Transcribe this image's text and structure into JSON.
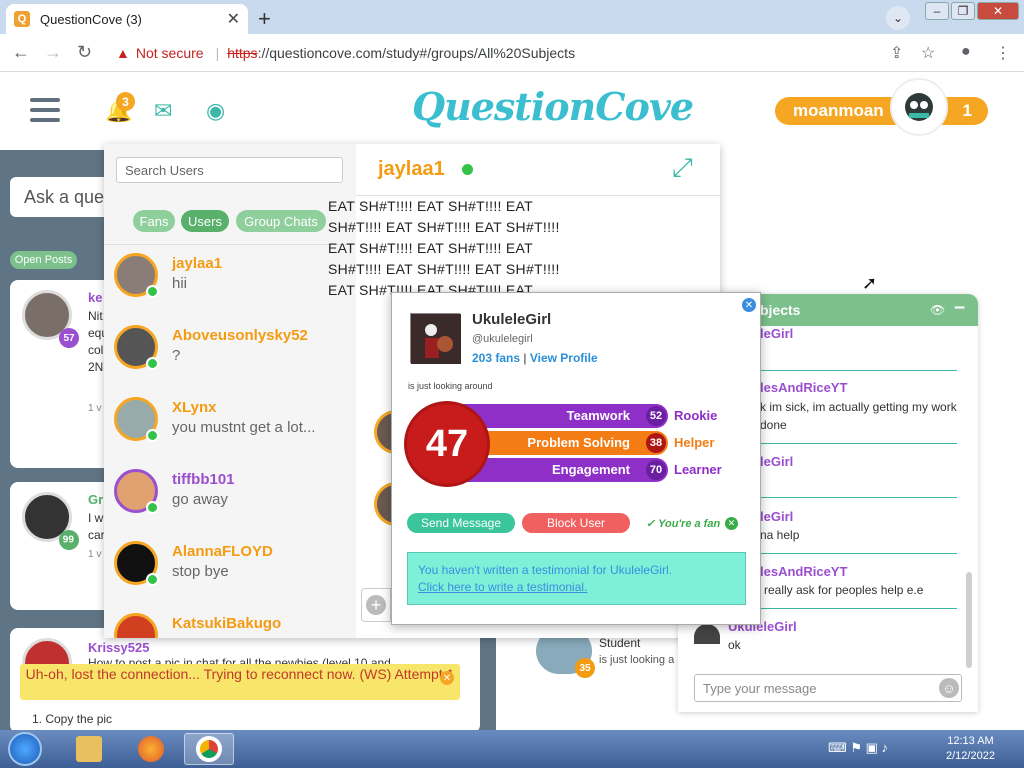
{
  "browser": {
    "tab_title": "QuestionCove (3)",
    "favicon_letter": "Q",
    "address": {
      "security_label": "Not secure",
      "url_scheme": "https",
      "url_rest": "://questioncove.com/study#/groups/All%20Subjects"
    }
  },
  "header": {
    "bell_count": "3",
    "logo_text": "QuestionCove",
    "username": "moanmoan",
    "user_count": "1"
  },
  "feed": {
    "ask_placeholder": "Ask a que",
    "tab_open_posts": "Open Posts",
    "posts": [
      {
        "badge": "57",
        "name_fragment": "ke",
        "text_fragment": "Nit equ col 2N",
        "meta_fragment": "1 v"
      },
      {
        "badge": "99",
        "name_fragment": "Gr",
        "text_fragment": "I w car",
        "meta_fragment": "1 v"
      }
    ],
    "krissy": {
      "name": "Krissy525",
      "text": "How to post a pic in chat for all the newbies (level 10 and",
      "copy": "1. Copy the pic"
    },
    "reconnect_text": "Uh-oh, lost the connection... Trying to reconnect now. (WS) Attempt 1"
  },
  "chat": {
    "search_placeholder": "Search Users",
    "filters": [
      "Fans",
      "Users",
      "Group Chats"
    ],
    "active_filter": "Users",
    "partner": "jaylaa1",
    "conversations": [
      {
        "name": "jaylaa1",
        "message": "hii",
        "color": "orange"
      },
      {
        "name": "Aboveusonlysky52",
        "message": "?",
        "color": "orange"
      },
      {
        "name": "XLynx",
        "message": "you mustnt get a lot...",
        "color": "orange"
      },
      {
        "name": "tiffbb101",
        "message": "go away",
        "color": "purple"
      },
      {
        "name": "AlannaFLOYD",
        "message": "stop bye",
        "color": "orange"
      },
      {
        "name": "KatsukiBakugo",
        "message": "",
        "color": "orange"
      }
    ],
    "body_lines": [
      "EAT SH#T!!!! EAT SH#T!!!! EAT",
      "SH#T!!!! EAT SH#T!!!! EAT SH#T!!!!",
      "EAT SH#T!!!! EAT SH#T!!!! EAT",
      "SH#T!!!! EAT SH#T!!!! EAT SH#T!!!!",
      "EAT SH#T!!!! EAT SH#T!!!! EAT"
    ]
  },
  "group_chat": {
    "title": "bjects",
    "messages": [
      {
        "name": "leGirl",
        "text": ""
      },
      {
        "name": "lesAndRiceYT",
        "text": "k im sick, im actually getting my work done"
      },
      {
        "name": "leGirl",
        "text": ""
      },
      {
        "name": "leGirl",
        "text": "na help"
      },
      {
        "name": "lesAndRiceYT",
        "text": "really ask for peoples help e.e"
      },
      {
        "name": "UkuleleGirl",
        "text": "ok"
      }
    ],
    "input_placeholder": "Type your message"
  },
  "student_card": {
    "role": "Student",
    "status": "is just looking a",
    "badge": "35"
  },
  "profile": {
    "name": "UkuleleGirl",
    "handle": "@ukulelegirl",
    "fans_text": "203 fans",
    "view_profile": "View Profile",
    "separator": "|",
    "status": "is just looking around",
    "score": "47",
    "bars": [
      {
        "label": "Teamwork",
        "value": "52",
        "rank": "Rookie"
      },
      {
        "label": "Problem Solving",
        "value": "38",
        "rank": "Helper"
      },
      {
        "label": "Engagement",
        "value": "70",
        "rank": "Learner"
      }
    ],
    "send_message": "Send Message",
    "block_user": "Block User",
    "fan_status": "✓ You're a fan",
    "testimonial_text": "You haven't written a testimonial for UkuleleGirl.",
    "testimonial_link": "Click here to write a testimonial."
  },
  "taskbar": {
    "time": "12:13 AM",
    "date": "2/12/2022"
  },
  "colors": {
    "brand_teal": "#3bbfd0",
    "orange": "#f5a623",
    "purple": "#9a4fd0",
    "green": "#58b06a",
    "red_score": "#c81c1c"
  }
}
